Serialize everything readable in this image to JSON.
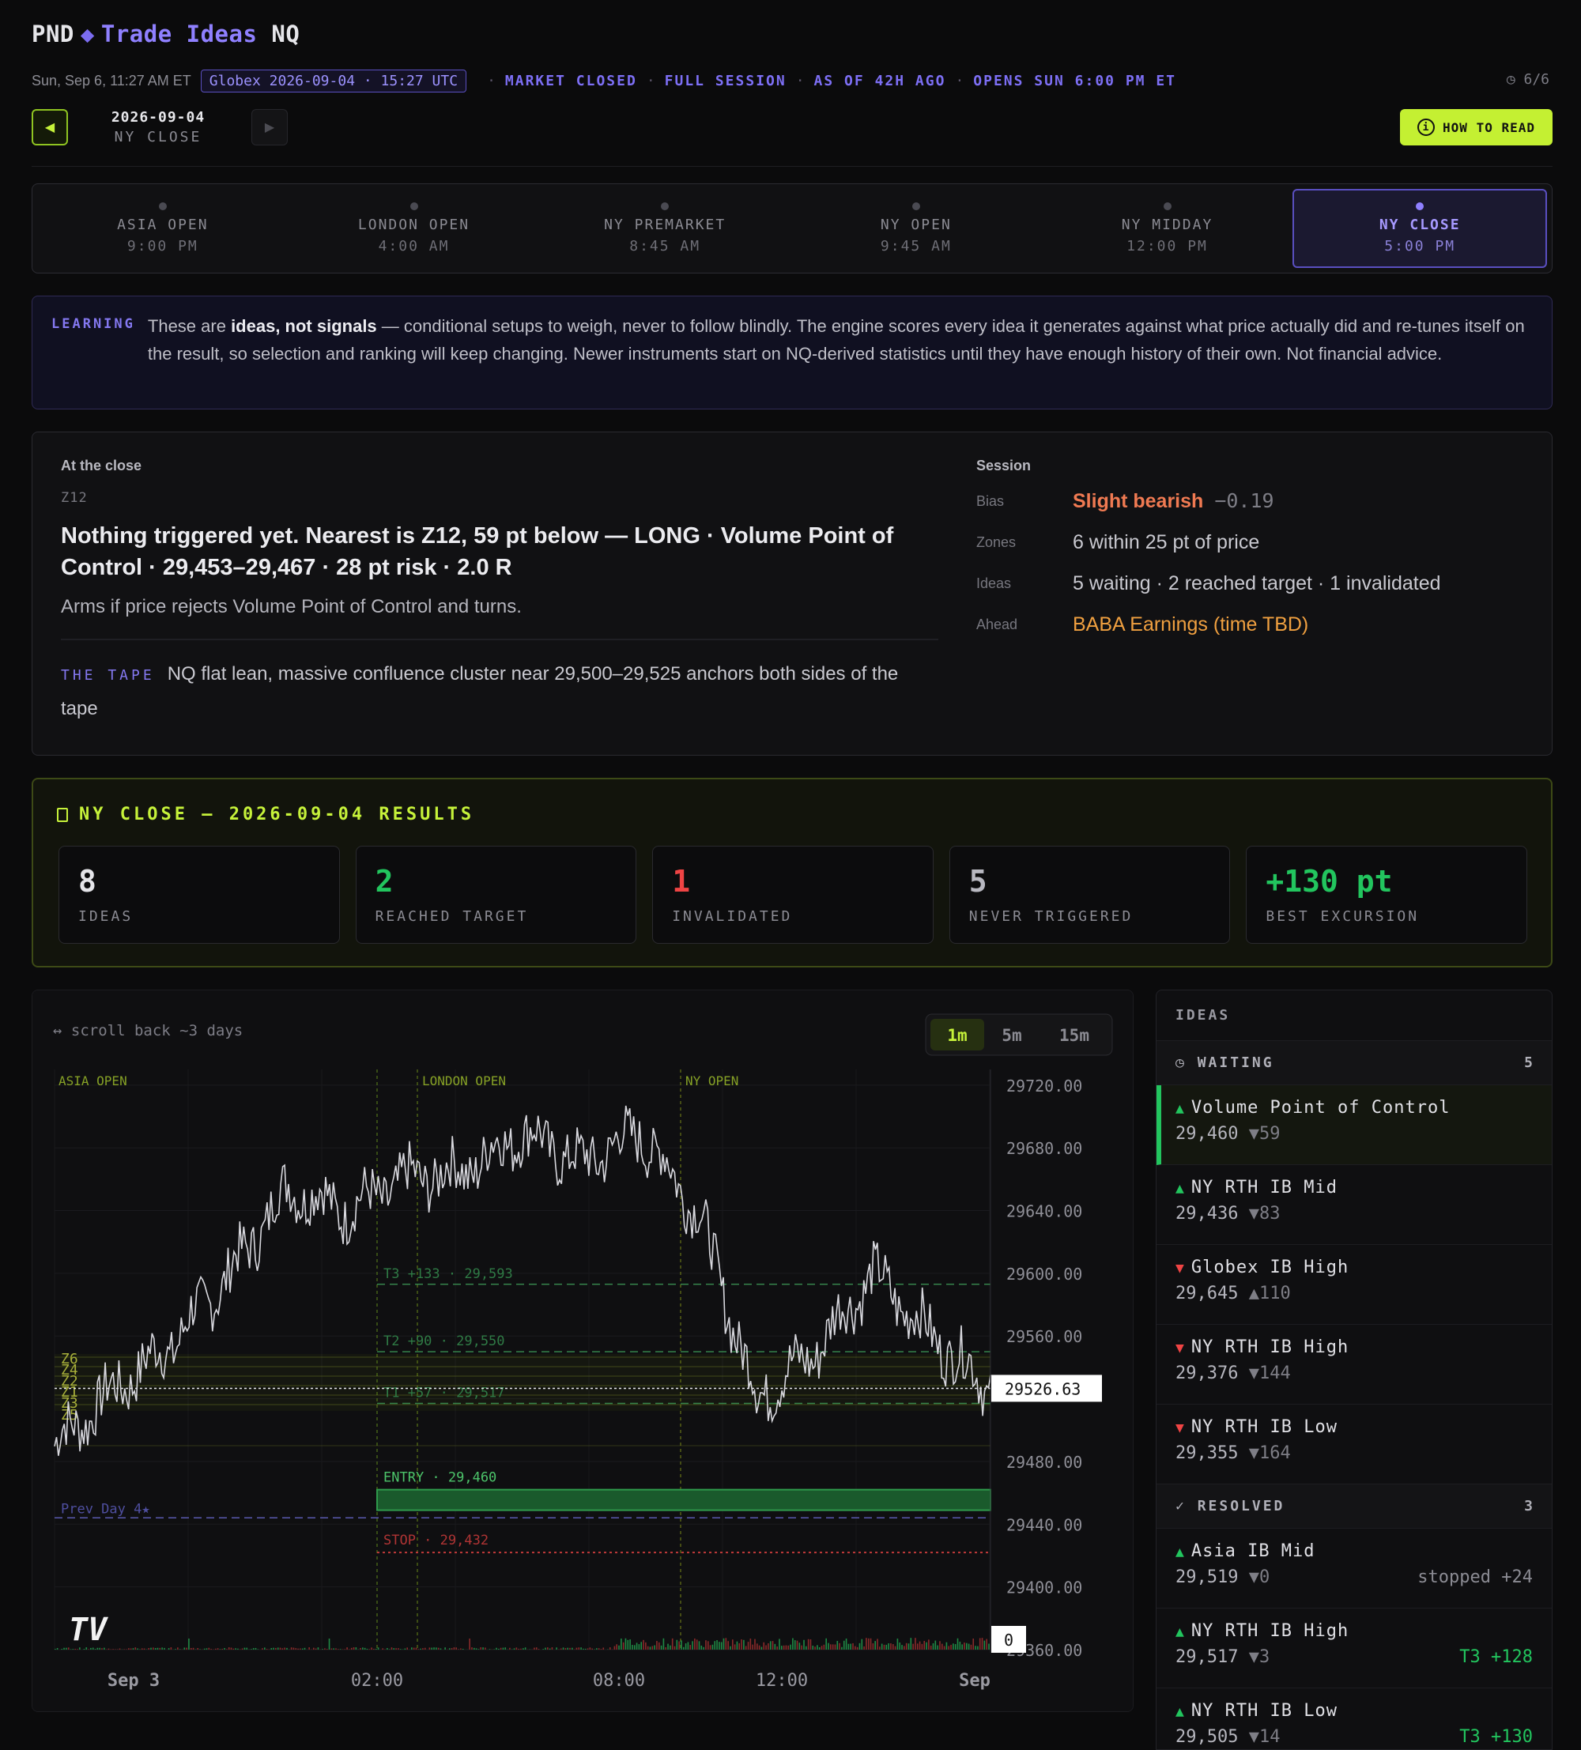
{
  "header": {
    "brand": "PND",
    "app_title": "Trade Ideas",
    "instrument": "NQ",
    "local_time": "Sun, Sep 6, 11:27 AM ET",
    "globex_time": "Globex 2026-09-04 · 15:27 UTC",
    "status_chips": [
      "MARKET CLOSED",
      "FULL SESSION",
      "AS OF 42H AGO",
      "OPENS SUN 6:00 PM ET"
    ],
    "pager": "◷ 6/6",
    "nav_date": "2026-09-04",
    "nav_session": "NY CLOSE",
    "prev_icon": "◀",
    "next_icon": "▶",
    "how_to_read": "HOW TO READ",
    "info_icon": "i"
  },
  "sessions": [
    {
      "name": "ASIA OPEN",
      "time": "9:00 PM"
    },
    {
      "name": "LONDON OPEN",
      "time": "4:00 AM"
    },
    {
      "name": "NY PREMARKET",
      "time": "8:45 AM"
    },
    {
      "name": "NY OPEN",
      "time": "9:45 AM"
    },
    {
      "name": "NY MIDDAY",
      "time": "12:00 PM"
    },
    {
      "name": "NY CLOSE",
      "time": "5:00 PM",
      "active": true
    }
  ],
  "learning": {
    "tag": "LEARNING",
    "text_pre": "These are ",
    "text_bold": "ideas, not signals",
    "text_post": " — conditional setups to weigh, never to follow blindly. The engine scores every idea it generates against what price actually did and re-tunes itself on the result, so selection and ranking will keep changing. Newer instruments start on NQ-derived statistics until they have enough history of their own. Not financial advice."
  },
  "close_panel": {
    "heading": "At the close",
    "zone": "Z12",
    "headline": "Nothing triggered yet. Nearest is Z12, 59 pt below — LONG · Volume Point of Control · 29,453–29,467 · 28 pt risk · 2.0 R",
    "subtext": "Arms if price rejects Volume Point of Control and turns.",
    "tape_label": "THE TAPE",
    "tape_text": "NQ flat lean, massive confluence cluster near 29,500–29,525 anchors both sides of the tape",
    "session_heading": "Session",
    "bias_label": "Bias",
    "bias_value": "Slight bearish",
    "bias_score": "−0.19",
    "zones_label": "Zones",
    "zones_value": "6 within 25 pt of price",
    "ideas_label": "Ideas",
    "ideas_value": "5 waiting · 2 reached target · 1 invalidated",
    "ahead_label": "Ahead",
    "ahead_value": "BABA Earnings (time TBD)"
  },
  "results": {
    "title": "NY CLOSE — 2026-09-04 RESULTS",
    "stats": [
      {
        "value": "8",
        "label": "IDEAS",
        "color": "#e4e4e8"
      },
      {
        "value": "2",
        "label": "REACHED TARGET",
        "color": "#22c55e"
      },
      {
        "value": "1",
        "label": "INVALIDATED",
        "color": "#ef4444"
      },
      {
        "value": "5",
        "label": "NEVER TRIGGERED",
        "color": "#b8b8c0"
      },
      {
        "value": "+130 pt",
        "label": "BEST EXCURSION",
        "color": "#22c55e"
      }
    ]
  },
  "chart": {
    "scroll_hint": "↔ scroll back ~3 days",
    "timeframes": [
      "1m",
      "5m",
      "15m"
    ],
    "active_timeframe": "1m",
    "session_labels": [
      "ASIA OPEN",
      "LONDON OPEN",
      "NY OPEN"
    ],
    "y_ticks": [
      "29720.00",
      "29680.00",
      "29640.00",
      "29600.00",
      "29560.00",
      "29480.00",
      "29440.00",
      "29400.00",
      "29360.00"
    ],
    "x_ticks": [
      "Sep 3",
      "02:00",
      "08:00",
      "12:00",
      "Sep"
    ],
    "last_price": "29526.63",
    "volume_readout": "0",
    "zone_labels": [
      "Z6",
      "Z4",
      "Z2",
      "Z1",
      "Z3",
      "Z5"
    ],
    "levels": {
      "t3": "T3 +133 · 29,593",
      "t2": "T2 +90 · 29,550",
      "t1": "T1 +57 · 29,517",
      "entry": "ENTRY · 29,460",
      "stop": "STOP · 29,432",
      "prev_day": "Prev Day 4★"
    },
    "logo": "TV"
  },
  "chart_data": {
    "type": "line",
    "title": "",
    "ylim": [
      29360,
      29730
    ],
    "series": [
      {
        "name": "NQ",
        "x": [
          0,
          60,
          120,
          180,
          240,
          300,
          360,
          420,
          480,
          540,
          600,
          660,
          720,
          780,
          840,
          900,
          960
        ],
        "values": [
          29490,
          29525,
          29555,
          29600,
          29655,
          29640,
          29660,
          29665,
          29690,
          29670,
          29690,
          29640,
          29520,
          29550,
          29600,
          29560,
          29527
        ]
      }
    ],
    "levels": {
      "t3": 29593,
      "t2": 29550,
      "t1": 29517,
      "entry": 29460,
      "stop": 29432
    },
    "last_price": 29526.63,
    "grid": true
  },
  "ideas": {
    "title": "IDEAS",
    "waiting_label": "WAITING",
    "waiting_count": "5",
    "waiting": [
      {
        "dir": "▲",
        "up": true,
        "name": "Volume Point of Control",
        "price": "29,460",
        "dist": "▼59",
        "selected": true
      },
      {
        "dir": "▲",
        "up": true,
        "name": "NY RTH IB Mid",
        "price": "29,436",
        "dist": "▼83"
      },
      {
        "dir": "▼",
        "up": false,
        "name": "Globex IB High",
        "price": "29,645",
        "dist": "▲110"
      },
      {
        "dir": "▼",
        "up": false,
        "name": "NY RTH IB High",
        "price": "29,376",
        "dist": "▼144"
      },
      {
        "dir": "▼",
        "up": false,
        "name": "NY RTH IB Low",
        "price": "29,355",
        "dist": "▼164"
      }
    ],
    "resolved_label": "RESOLVED",
    "resolved_count": "3",
    "resolved": [
      {
        "dir": "▲",
        "up": true,
        "name": "Asia IB Mid",
        "price": "29,519",
        "dist": "▼0",
        "result": "stopped +24",
        "result_color": "gray"
      },
      {
        "dir": "▲",
        "up": true,
        "name": "NY RTH IB High",
        "price": "29,517",
        "dist": "▼3",
        "result": "T3 +128",
        "result_color": "green"
      },
      {
        "dir": "▲",
        "up": true,
        "name": "NY RTH IB Low",
        "price": "29,505",
        "dist": "▼14",
        "result": "T3 +130",
        "result_color": "green"
      }
    ]
  }
}
